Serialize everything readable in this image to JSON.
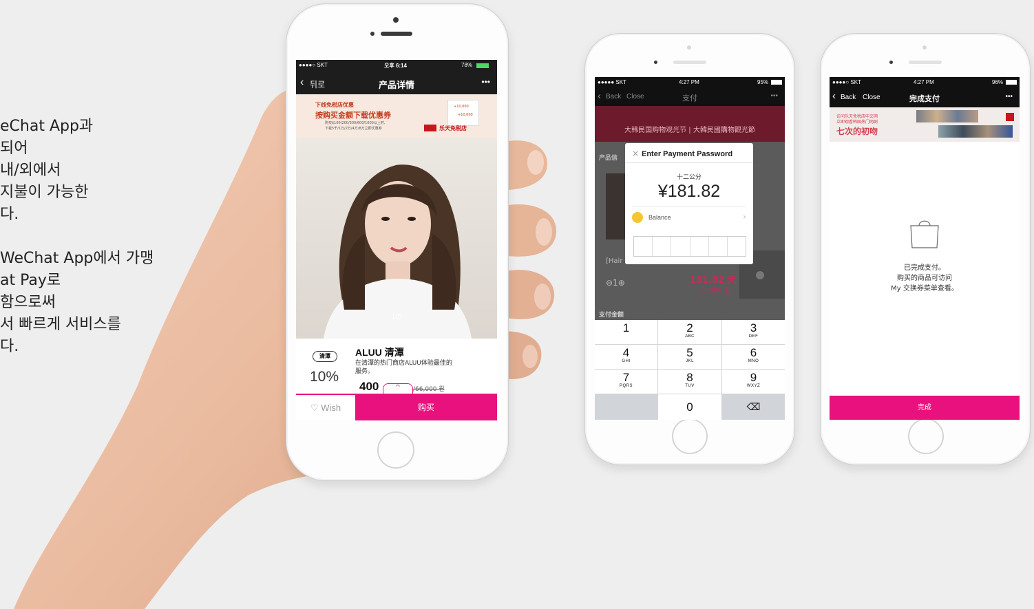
{
  "left_text": {
    "block1": [
      "eChat App과",
      "되어",
      "내/외에서",
      "지불이 가능한",
      "다."
    ],
    "block2": [
      "WeChat App에서 가맹",
      "at Pay로",
      "함으로써",
      "서 빠르게 서비스를",
      "다."
    ]
  },
  "phone1": {
    "status": {
      "carrier": "●●●●○ SKT",
      "time": "오후 6:14",
      "battery": "78%"
    },
    "nav": {
      "back": "뒤로",
      "title": "产品详情",
      "more": "•••"
    },
    "banner": {
      "line1": "下线免税店优惠",
      "line2": "按购买金额下载优惠券",
      "line3": "购买$100/200/300/600/1000以上时,",
      "line4": "下载5千/1万/2万/4万/8万立即优惠券",
      "logo_text": "乐天免税店",
      "amount1": "+10,000",
      "amount2": "+10,000"
    },
    "photo_counter": "1/5",
    "product": {
      "badge": "清潭",
      "discount": "10%",
      "name": "ALUU 清潭",
      "desc_line1": "在清潭的热门商店ALUU体验最佳的",
      "desc_line2": "服务。",
      "price_prefix": "400",
      "price_strike": "/66,000 원"
    },
    "wish_label": "Wish",
    "buy_label": "购买"
  },
  "phone2": {
    "status": {
      "carrier": "●●●●● SKT",
      "time": "4:27 PM",
      "battery": "95%"
    },
    "nav": {
      "back": "Back",
      "close": "Close",
      "title": "支付",
      "more": "•••"
    },
    "banner_text": "大韩民国购物观光节 | 大韓民國購物觀光節",
    "bg_label_product": "产品信",
    "bg_label_hair": "[Hair",
    "bg_qty": "1",
    "bg_price": "181.82 元",
    "bg_price_krw": "30,000 원",
    "bg_pay_label": "支付金额",
    "dialog": {
      "close": "×",
      "title": "Enter Payment Password",
      "merchant": "十二公分",
      "amount": "¥181.82",
      "method": "Balance"
    },
    "keypad": [
      {
        "num": "1",
        "sub": ""
      },
      {
        "num": "2",
        "sub": "ABC"
      },
      {
        "num": "3",
        "sub": "DEF"
      },
      {
        "num": "4",
        "sub": "GHI"
      },
      {
        "num": "5",
        "sub": "JKL"
      },
      {
        "num": "6",
        "sub": "MNO"
      },
      {
        "num": "7",
        "sub": "PQRS"
      },
      {
        "num": "8",
        "sub": "TUV"
      },
      {
        "num": "9",
        "sub": "WXYZ"
      },
      {
        "num": "0",
        "sub": ""
      }
    ]
  },
  "phone3": {
    "status": {
      "carrier": "●●●●○ SKT",
      "time": "4:27 PM",
      "battery": "96%"
    },
    "nav": {
      "back": "Back",
      "close": "Close",
      "title": "完成支付",
      "more": "•••"
    },
    "banner": {
      "line1": "访问乐天免税店中文网",
      "line2": "立即观看韩国热门网剧",
      "line3": "七次的初吻"
    },
    "message": [
      "已完成支付。",
      "购买的商品可访问",
      "My 交换券菜单查看。"
    ],
    "done_label": "完成"
  },
  "colors": {
    "accent": "#e8117e",
    "navbar": "#1d1d1d",
    "banner_red": "#6d1a2c"
  }
}
